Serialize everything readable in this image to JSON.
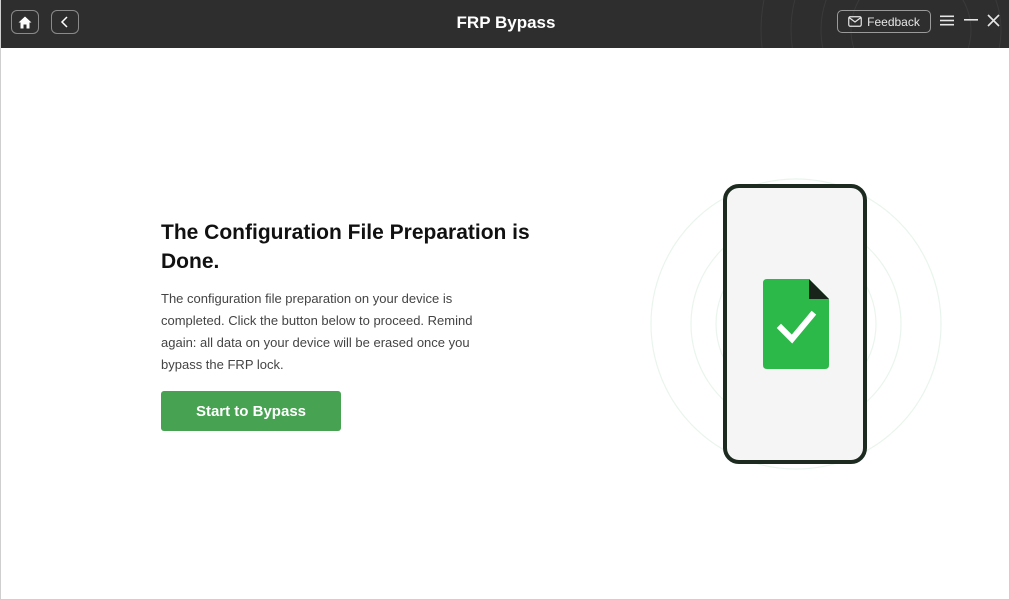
{
  "titlebar": {
    "title": "FRP Bypass",
    "home_icon": "home-icon",
    "back_icon": "chevron-left-icon",
    "feedback_label": "Feedback",
    "feedback_icon": "mail-icon",
    "menu_icon": "hamburger-menu-icon",
    "minimize_icon": "minimize-icon",
    "close_icon": "close-icon"
  },
  "main": {
    "heading": "The Configuration File Preparation is Done.",
    "description": "The configuration file preparation on your device is completed. Click the button below to proceed. Remind again: all data on your device will be erased once you bypass the FRP lock.",
    "button_label": "Start to Bypass"
  },
  "illustration": {
    "phone_icon": "phone-icon",
    "file_icon": "file-check-icon"
  },
  "colors": {
    "titlebar_bg": "#2e2e2e",
    "accent_green": "#47a352",
    "file_green": "#2db84a"
  }
}
